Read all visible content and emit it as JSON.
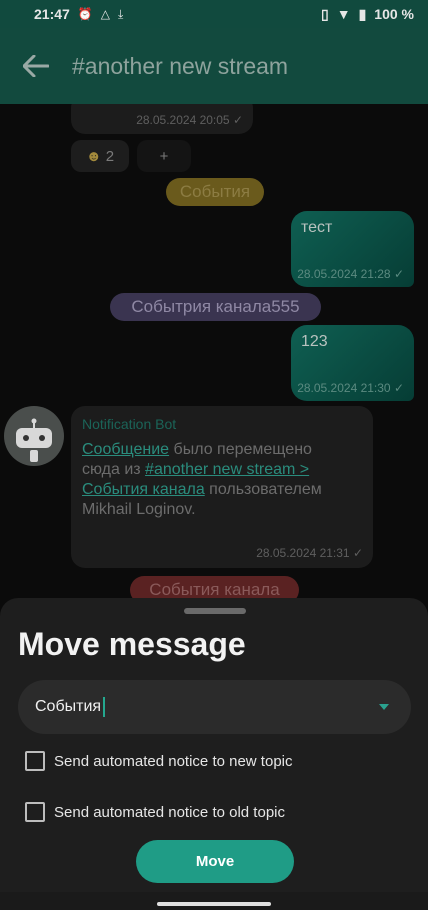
{
  "status": {
    "time": "21:47",
    "battery": "100 %"
  },
  "header": {
    "title": "#another new stream"
  },
  "messages": {
    "first_time": "28.05.2024 20:05 ✓",
    "reaction_count": "2",
    "add_reaction": "+",
    "topic1": "События",
    "msg2_text": "тест",
    "msg2_time": "28.05.2024 21:28 ✓",
    "topic2": "Событрия канала555",
    "msg3_text": "123",
    "msg3_time": "28.05.2024 21:30 ✓",
    "bot_name": "Notification Bot",
    "bot_link1": "Сообщение",
    "bot_text1": " было перемещено сюда из ",
    "bot_link2": "#another new stream > События канала",
    "bot_text2": " пользователем Mikhail Loginov.",
    "bot_time": "28.05.2024 21:31 ✓",
    "topic3": "События канала"
  },
  "sheet": {
    "title": "Move message",
    "topic_value": "События",
    "check_new": "Send automated notice to new topic",
    "check_old": "Send automated notice to old topic",
    "move_label": "Move"
  },
  "colors": {
    "accent": "#1f9c86",
    "appbar": "#124a3e"
  }
}
